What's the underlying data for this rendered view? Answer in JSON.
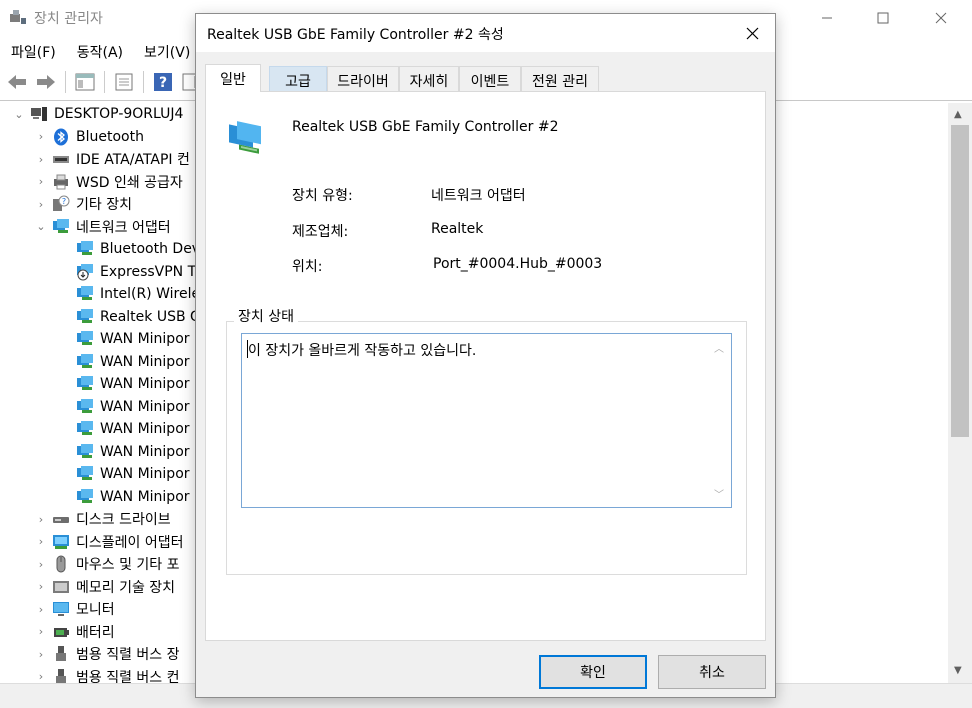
{
  "background_window": {
    "title": "장치 관리자",
    "menu": [
      "파일(F)",
      "동작(A)",
      "보기(V)"
    ],
    "tree": [
      {
        "label": "DESKTOP-9ORLUJ4",
        "level": 0,
        "arrow": "expanded",
        "icon": "computer-icon"
      },
      {
        "label": "Bluetooth",
        "level": 1,
        "arrow": "collapsed",
        "icon": "bluetooth-icon"
      },
      {
        "label": "IDE ATA/ATAPI 컨",
        "level": 1,
        "arrow": "collapsed",
        "icon": "ide-controller-icon"
      },
      {
        "label": "WSD 인쇄 공급자",
        "level": 1,
        "arrow": "collapsed",
        "icon": "printer-icon"
      },
      {
        "label": "기타 장치",
        "level": 1,
        "arrow": "collapsed",
        "icon": "unknown-device-icon"
      },
      {
        "label": "네트워크 어댑터",
        "level": 1,
        "arrow": "expanded",
        "icon": "network-adapter-icon"
      },
      {
        "label": "Bluetooth Dev",
        "level": 2,
        "arrow": "none",
        "icon": "network-adapter-icon"
      },
      {
        "label": "ExpressVPN TA",
        "level": 2,
        "arrow": "none",
        "icon": "network-adapter-disabled-icon"
      },
      {
        "label": "Intel(R) Wirele",
        "level": 2,
        "arrow": "none",
        "icon": "network-adapter-icon"
      },
      {
        "label": "Realtek USB G",
        "level": 2,
        "arrow": "none",
        "icon": "network-adapter-icon"
      },
      {
        "label": "WAN Minipor",
        "level": 2,
        "arrow": "none",
        "icon": "network-adapter-icon"
      },
      {
        "label": "WAN Minipor",
        "level": 2,
        "arrow": "none",
        "icon": "network-adapter-icon"
      },
      {
        "label": "WAN Minipor",
        "level": 2,
        "arrow": "none",
        "icon": "network-adapter-icon"
      },
      {
        "label": "WAN Minipor",
        "level": 2,
        "arrow": "none",
        "icon": "network-adapter-icon"
      },
      {
        "label": "WAN Minipor",
        "level": 2,
        "arrow": "none",
        "icon": "network-adapter-icon"
      },
      {
        "label": "WAN Minipor",
        "level": 2,
        "arrow": "none",
        "icon": "network-adapter-icon"
      },
      {
        "label": "WAN Minipor",
        "level": 2,
        "arrow": "none",
        "icon": "network-adapter-icon"
      },
      {
        "label": "WAN Minipor",
        "level": 2,
        "arrow": "none",
        "icon": "network-adapter-icon"
      },
      {
        "label": "디스크 드라이브",
        "level": 1,
        "arrow": "collapsed",
        "icon": "disk-drive-icon"
      },
      {
        "label": "디스플레이 어댑터",
        "level": 1,
        "arrow": "collapsed",
        "icon": "display-adapter-icon"
      },
      {
        "label": "마우스 및 기타 포",
        "level": 1,
        "arrow": "collapsed",
        "icon": "mouse-icon"
      },
      {
        "label": "메모리 기술 장치",
        "level": 1,
        "arrow": "collapsed",
        "icon": "memory-icon"
      },
      {
        "label": "모니터",
        "level": 1,
        "arrow": "collapsed",
        "icon": "monitor-icon"
      },
      {
        "label": "배터리",
        "level": 1,
        "arrow": "collapsed",
        "icon": "battery-icon"
      },
      {
        "label": "범용 직렬 버스 장",
        "level": 1,
        "arrow": "collapsed",
        "icon": "usb-icon"
      },
      {
        "label": "범용 직렬 버스 컨",
        "level": 1,
        "arrow": "collapsed",
        "icon": "usb-icon"
      }
    ]
  },
  "dialog": {
    "title": "Realtek USB GbE Family Controller #2 속성",
    "tabs": [
      "일반",
      "고급",
      "드라이버",
      "자세히",
      "이벤트",
      "전원 관리"
    ],
    "active_tab": "일반",
    "device_name": "Realtek USB GbE Family Controller #2",
    "properties": [
      {
        "label": "장치 유형:",
        "value": "네트워크 어댑터"
      },
      {
        "label": "제조업체:",
        "value": "Realtek"
      },
      {
        "label": "위치:",
        "value": "Port_#0004.Hub_#0003"
      }
    ],
    "status_group_label": "장치 상태",
    "status_text": "이 장치가 올바르게 작동하고 있습니다.",
    "ok_label": "확인",
    "cancel_label": "취소"
  },
  "colors": {
    "accent": "#0078d7",
    "tab_hover": "#d8e6f2",
    "dialog_bg": "#f0f0f0"
  }
}
